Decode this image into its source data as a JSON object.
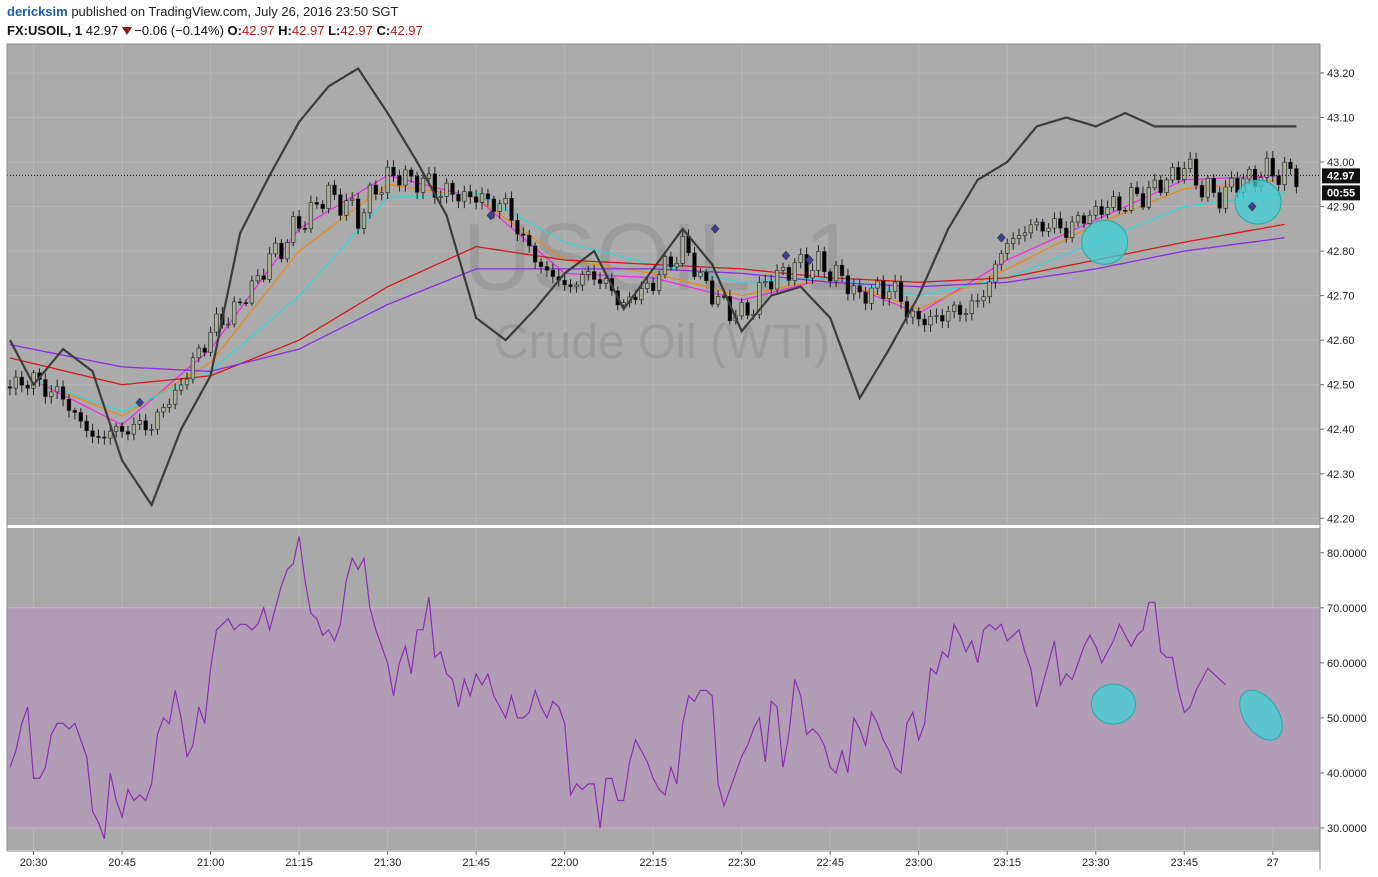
{
  "header": {
    "author": "dericksim",
    "published": "published on TradingView.com, July 26, 2016 23:50 SGT",
    "symbol": "FX:USOIL, 1",
    "last": "42.97",
    "change": "−0.06 (−0.14%)",
    "o_label": "O:",
    "o_value": "42.97",
    "h_label": "H:",
    "h_value": "42.97",
    "l_label": "L:",
    "l_value": "42.97",
    "c_label": "C:",
    "c_value": "42.97"
  },
  "watermark": {
    "symbol": "USOIL, 1",
    "name": "Crude Oil (WTI)"
  },
  "price_badge": {
    "price": "42.97",
    "countdown": "00:55"
  },
  "colors": {
    "price_bg": "#ababab",
    "ind_bg": "#a9a9a9",
    "band": "#b39ab7",
    "bull": "#a9b09a",
    "bear": "#000000",
    "rsi": "#8a2fb0",
    "stoch": "#3c3c3c",
    "ema_fast": "#e92fe0",
    "ema_mid": "#e88a1e",
    "ema_cyan": "#36d4d8",
    "ema_red": "#d41a1a",
    "ema_purple": "#8a2be2",
    "marker": "#3f3f8f",
    "highlight": "#3dd0d6"
  },
  "chart_data": [
    {
      "type": "candlestick",
      "symbol": "FX:USOIL, 1",
      "x_ticks": [
        "20:30",
        "20:45",
        "21:00",
        "21:15",
        "21:30",
        "21:45",
        "22:00",
        "22:15",
        "22:30",
        "22:45",
        "23:00",
        "23:15",
        "23:30",
        "23:45",
        "27"
      ],
      "y_ticks": [
        "43.20",
        "43.10",
        "43.00",
        "42.90",
        "42.80",
        "42.70",
        "42.60",
        "42.50",
        "42.40",
        "42.30",
        "42.20"
      ],
      "ylim": [
        42.185,
        43.265
      ],
      "xlim_minutes": [
        -4.5,
        218
      ],
      "last_price": 42.97,
      "close_series": {
        "t": [
          -4,
          0,
          5,
          10,
          15,
          20,
          25,
          30,
          35,
          40,
          45,
          50,
          55,
          60,
          65,
          70,
          75,
          80,
          85,
          90,
          95,
          100,
          105,
          110,
          115,
          120,
          125,
          130,
          135,
          140,
          145,
          150,
          155,
          160,
          165,
          170,
          175,
          180,
          185,
          190,
          195,
          200,
          205,
          210,
          214
        ],
        "close": [
          42.5,
          42.51,
          42.47,
          42.38,
          42.4,
          42.41,
          42.5,
          42.62,
          42.68,
          42.78,
          42.86,
          42.93,
          42.88,
          42.97,
          42.96,
          42.93,
          42.92,
          42.9,
          42.78,
          42.72,
          42.75,
          42.68,
          42.73,
          42.81,
          42.7,
          42.65,
          42.74,
          42.77,
          42.76,
          42.7,
          42.72,
          42.64,
          42.66,
          42.68,
          42.82,
          42.86,
          42.85,
          42.89,
          42.91,
          42.94,
          42.99,
          42.92,
          42.96,
          42.98,
          42.97
        ]
      },
      "overlays": [
        {
          "name": "stochastic-style oscillator",
          "color": "#3c3c3c",
          "t": [
            -4,
            0,
            5,
            10,
            15,
            20,
            25,
            30,
            35,
            40,
            45,
            50,
            55,
            60,
            65,
            70,
            75,
            80,
            85,
            90,
            95,
            100,
            105,
            110,
            115,
            120,
            125,
            130,
            135,
            140,
            145,
            150,
            155,
            160,
            165,
            170,
            175,
            180,
            185,
            190,
            195,
            200,
            205,
            210,
            214
          ],
          "value": [
            42.6,
            42.5,
            42.58,
            42.53,
            42.33,
            42.23,
            42.4,
            42.52,
            42.84,
            42.97,
            43.09,
            43.17,
            43.21,
            43.11,
            43.0,
            42.88,
            42.65,
            42.6,
            42.67,
            42.75,
            42.8,
            42.67,
            42.76,
            42.85,
            42.77,
            42.62,
            42.7,
            42.72,
            42.65,
            42.47,
            42.58,
            42.7,
            42.85,
            42.96,
            43.0,
            43.08,
            43.1,
            43.08,
            43.11,
            43.08,
            43.08,
            43.08,
            43.08,
            43.08,
            43.08
          ]
        },
        {
          "name": "ema-magenta",
          "color": "#e92fe0",
          "t": [
            0,
            15,
            30,
            45,
            60,
            75,
            90,
            105,
            120,
            135,
            150,
            165,
            180,
            195,
            212
          ],
          "value": [
            42.51,
            42.41,
            42.58,
            42.85,
            42.97,
            42.92,
            42.75,
            42.74,
            42.69,
            42.74,
            42.66,
            42.78,
            42.87,
            42.96,
            42.97
          ]
        },
        {
          "name": "ema-orange",
          "color": "#e88a1e",
          "t": [
            0,
            15,
            30,
            45,
            60,
            75,
            90,
            105,
            120,
            135,
            150,
            165,
            180,
            195,
            212
          ],
          "value": [
            42.51,
            42.43,
            42.55,
            42.8,
            42.95,
            42.92,
            42.78,
            42.75,
            42.7,
            42.74,
            42.67,
            42.76,
            42.86,
            42.94,
            42.96
          ]
        },
        {
          "name": "ema-cyan",
          "color": "#36d4d8",
          "t": [
            0,
            15,
            30,
            45,
            60,
            75,
            90,
            105,
            120,
            135,
            150,
            165,
            180,
            195,
            212
          ],
          "value": [
            42.51,
            42.44,
            42.53,
            42.7,
            42.92,
            42.93,
            42.82,
            42.77,
            42.73,
            42.74,
            42.7,
            42.74,
            42.82,
            42.9,
            42.93
          ]
        },
        {
          "name": "ema-red",
          "color": "#d41a1a",
          "t": [
            -4,
            15,
            30,
            45,
            60,
            75,
            90,
            105,
            120,
            135,
            150,
            165,
            180,
            195,
            212
          ],
          "value": [
            42.56,
            42.5,
            42.52,
            42.6,
            42.72,
            42.81,
            42.78,
            42.77,
            42.76,
            42.74,
            42.73,
            42.74,
            42.78,
            42.82,
            42.86
          ]
        },
        {
          "name": "ema-purple",
          "color": "#8a2be2",
          "t": [
            -4,
            15,
            30,
            45,
            60,
            75,
            90,
            105,
            120,
            135,
            150,
            165,
            180,
            195,
            212
          ],
          "value": [
            42.59,
            42.54,
            42.53,
            42.58,
            42.68,
            42.76,
            42.76,
            42.76,
            42.75,
            42.73,
            42.72,
            42.73,
            42.76,
            42.8,
            42.83
          ]
        }
      ],
      "markers": [
        {
          "t": 18,
          "price": 42.46
        },
        {
          "t": 77.5,
          "price": 42.88
        },
        {
          "t": 115.5,
          "price": 42.85
        },
        {
          "t": 127.5,
          "price": 42.79
        },
        {
          "t": 131.5,
          "price": 42.78
        },
        {
          "t": 164,
          "price": 42.83
        },
        {
          "t": 206.5,
          "price": 42.9
        }
      ],
      "highlights": [
        {
          "t": 181.5,
          "price": 42.82
        },
        {
          "t": 207.5,
          "price": 42.91
        }
      ]
    },
    {
      "type": "line",
      "name": "RSI",
      "y_ticks": [
        "80.0000",
        "70.0000",
        "60.0000",
        "50.0000",
        "40.0000",
        "30.0000"
      ],
      "ylim": [
        26,
        84.5
      ],
      "band": [
        30,
        70
      ],
      "x": [
        -4,
        -3,
        -2,
        -1,
        0,
        1,
        2,
        3,
        4,
        5,
        6,
        7,
        8,
        9,
        10,
        11,
        12,
        13,
        14,
        15,
        16,
        17,
        18,
        19,
        20,
        21,
        22,
        23,
        24,
        25,
        26,
        27,
        28,
        29,
        30,
        31,
        32,
        33,
        34,
        35,
        36,
        37,
        38,
        39,
        40,
        41,
        42,
        43,
        44,
        45,
        46,
        47,
        48,
        49,
        50,
        51,
        52,
        53,
        54,
        55,
        56,
        57,
        58,
        59,
        60,
        61,
        62,
        63,
        64,
        65,
        66,
        67,
        68,
        69,
        70,
        71,
        72,
        73,
        74,
        75,
        76,
        77,
        78,
        79,
        80,
        81,
        82,
        83,
        84,
        85,
        86,
        87,
        88,
        89,
        90,
        91,
        92,
        93,
        94,
        95,
        96,
        97,
        98,
        99,
        100,
        101,
        102,
        103,
        104,
        105,
        106,
        107,
        108,
        109,
        110,
        111,
        112,
        113,
        114,
        115,
        116,
        117,
        118,
        119,
        120,
        121,
        122,
        123,
        124,
        125,
        126,
        127,
        128,
        129,
        130,
        131,
        132,
        133,
        134,
        135,
        136,
        137,
        138,
        139,
        140,
        141,
        142,
        143,
        144,
        145,
        146,
        147,
        148,
        149,
        150,
        151,
        152,
        153,
        154,
        155,
        156,
        157,
        158,
        159,
        160,
        161,
        162,
        163,
        164,
        165,
        166,
        167,
        168,
        169,
        170,
        171,
        172,
        173,
        174,
        175,
        176,
        177,
        178,
        179,
        180,
        181,
        182,
        183,
        184,
        185,
        186,
        187,
        188,
        189,
        190,
        191,
        192,
        193,
        194,
        195,
        196,
        197,
        198,
        199,
        200,
        201,
        202,
        203,
        204,
        205,
        206,
        207,
        208,
        209,
        210,
        211,
        212
      ],
      "values": [
        41,
        44,
        49,
        52,
        39,
        39,
        41,
        47,
        49,
        49,
        48,
        49,
        46,
        43,
        33,
        31,
        28,
        40,
        35,
        32,
        37,
        35,
        36,
        35,
        38,
        47,
        50,
        49,
        55,
        50,
        43,
        45,
        52,
        49,
        59,
        66,
        67,
        68,
        66,
        67,
        67,
        66,
        67,
        70,
        66,
        70,
        74,
        77,
        78,
        83,
        75,
        69,
        68,
        65,
        66,
        64,
        67,
        75,
        79,
        77,
        79,
        70,
        66,
        63,
        60,
        54,
        60,
        63,
        58,
        66,
        66,
        72,
        61,
        62,
        58,
        57,
        52,
        57,
        54,
        58,
        56,
        58,
        54,
        52,
        50,
        54,
        50,
        50,
        51,
        55,
        52,
        50,
        53,
        52,
        49,
        36,
        38,
        37,
        38,
        38,
        30,
        39,
        39,
        35,
        35,
        42,
        46,
        44,
        42,
        39,
        37,
        36,
        41,
        38,
        49,
        54,
        53,
        55,
        55,
        54,
        38,
        34,
        37,
        40,
        43,
        45,
        48,
        50,
        42,
        53,
        52,
        41,
        47,
        57,
        54,
        47,
        48,
        47,
        45,
        41,
        40,
        44,
        40,
        50,
        48,
        45,
        51,
        49,
        46,
        44,
        41,
        40,
        49,
        51,
        46,
        49,
        59,
        58,
        62,
        61,
        67,
        65,
        62,
        64,
        60,
        66,
        67,
        66,
        67,
        64,
        65,
        66,
        62,
        59,
        52,
        56,
        60,
        64,
        56,
        58,
        57,
        60,
        63,
        65,
        63,
        60,
        62,
        64,
        67,
        65,
        63,
        65,
        66,
        71,
        71,
        62,
        61,
        61,
        55,
        51,
        52,
        55,
        57,
        59,
        58,
        57,
        56
      ],
      "highlights": [
        {
          "t": 183,
          "value": 52.5
        },
        {
          "t": 208,
          "value": 50.5
        }
      ]
    }
  ]
}
